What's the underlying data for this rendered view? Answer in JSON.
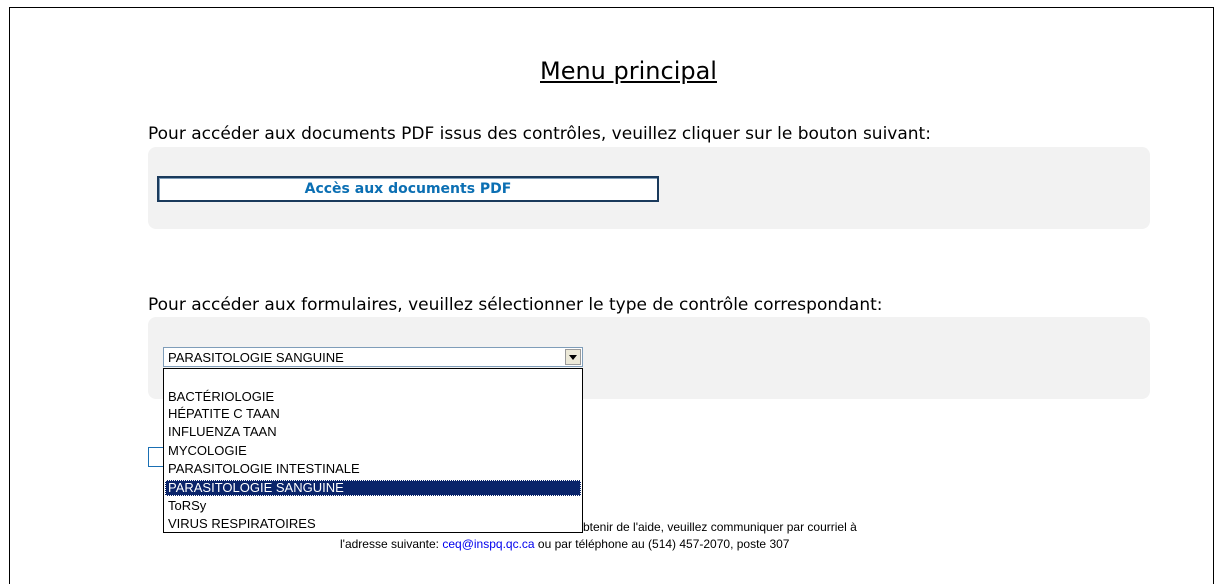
{
  "page": {
    "title": "Menu principal"
  },
  "pdf_section": {
    "instruction": "Pour accéder aux documents PDF issus des contrôles, veuillez cliquer sur le bouton suivant:",
    "button_label": "Accès aux documents PDF"
  },
  "forms_section": {
    "instruction": "Pour accéder aux formulaires, veuillez sélectionner le type de contrôle correspondant:",
    "select_value": "PARASITOLOGIE SANGUINE",
    "options": [
      "",
      "BACTÉRIOLOGIE",
      "HÉPATITE C TAAN",
      "INFLUENZA TAAN",
      "MYCOLOGIE",
      "PARASITOLOGIE INTESTINALE",
      "PARASITOLOGIE SANGUINE",
      "ToRSy",
      "VIRUS RESPIRATOIRES"
    ],
    "selected_index": 6
  },
  "footer": {
    "line1_visible": "btenir de l'aide, veuillez communiquer par courriel à",
    "line2_prefix": "l'adresse suivante: ",
    "email": "ceq@inspq.qc.ca",
    "line2_suffix": " ou par téléphone au (514) 457-2070, poste 307"
  },
  "colors": {
    "panel_bg": "#f2f2f2",
    "button_text": "#0b6fb3",
    "selected_bg": "#0a246a",
    "link": "#0000ee"
  }
}
